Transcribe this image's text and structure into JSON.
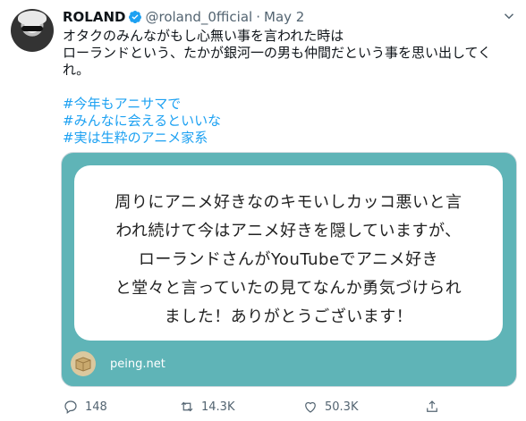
{
  "tweet": {
    "display_name": "ROLAND",
    "handle": "@roland_0fficial",
    "separator": "·",
    "date": "May 2",
    "text_lines": [
      "オタクのみんながもし心無い事を言われた時は",
      "ローランドという、たかが銀河一の男も仲間だという事を思い出してく",
      "れ。"
    ],
    "hashtags": [
      "#今年もアニサマで",
      "#みんなに会えるといいな",
      "#実は生粋のアニメ家系"
    ]
  },
  "card": {
    "question_lines": [
      "周りにアニメ好きなのキモいしカッコ悪いと言",
      "われ続けて今はアニメ好きを隠していますが、",
      "ローランドさんがYouTubeでアニメ好き",
      "と堂々と言っていたの見てなんか勇気づけられ",
      "ました！ありがとうございます！"
    ],
    "domain": "peing.net",
    "background_color": "#5fb4b7"
  },
  "actions": {
    "replies": "148",
    "retweets": "14.3K",
    "likes": "50.3K"
  },
  "colors": {
    "link": "#1da1f2",
    "muted": "#536471",
    "verified": "#1da1f2"
  },
  "icons": [
    "verified-badge-icon",
    "caret-down-icon",
    "reply-icon",
    "retweet-icon",
    "like-icon",
    "share-icon",
    "peing-box-icon"
  ]
}
